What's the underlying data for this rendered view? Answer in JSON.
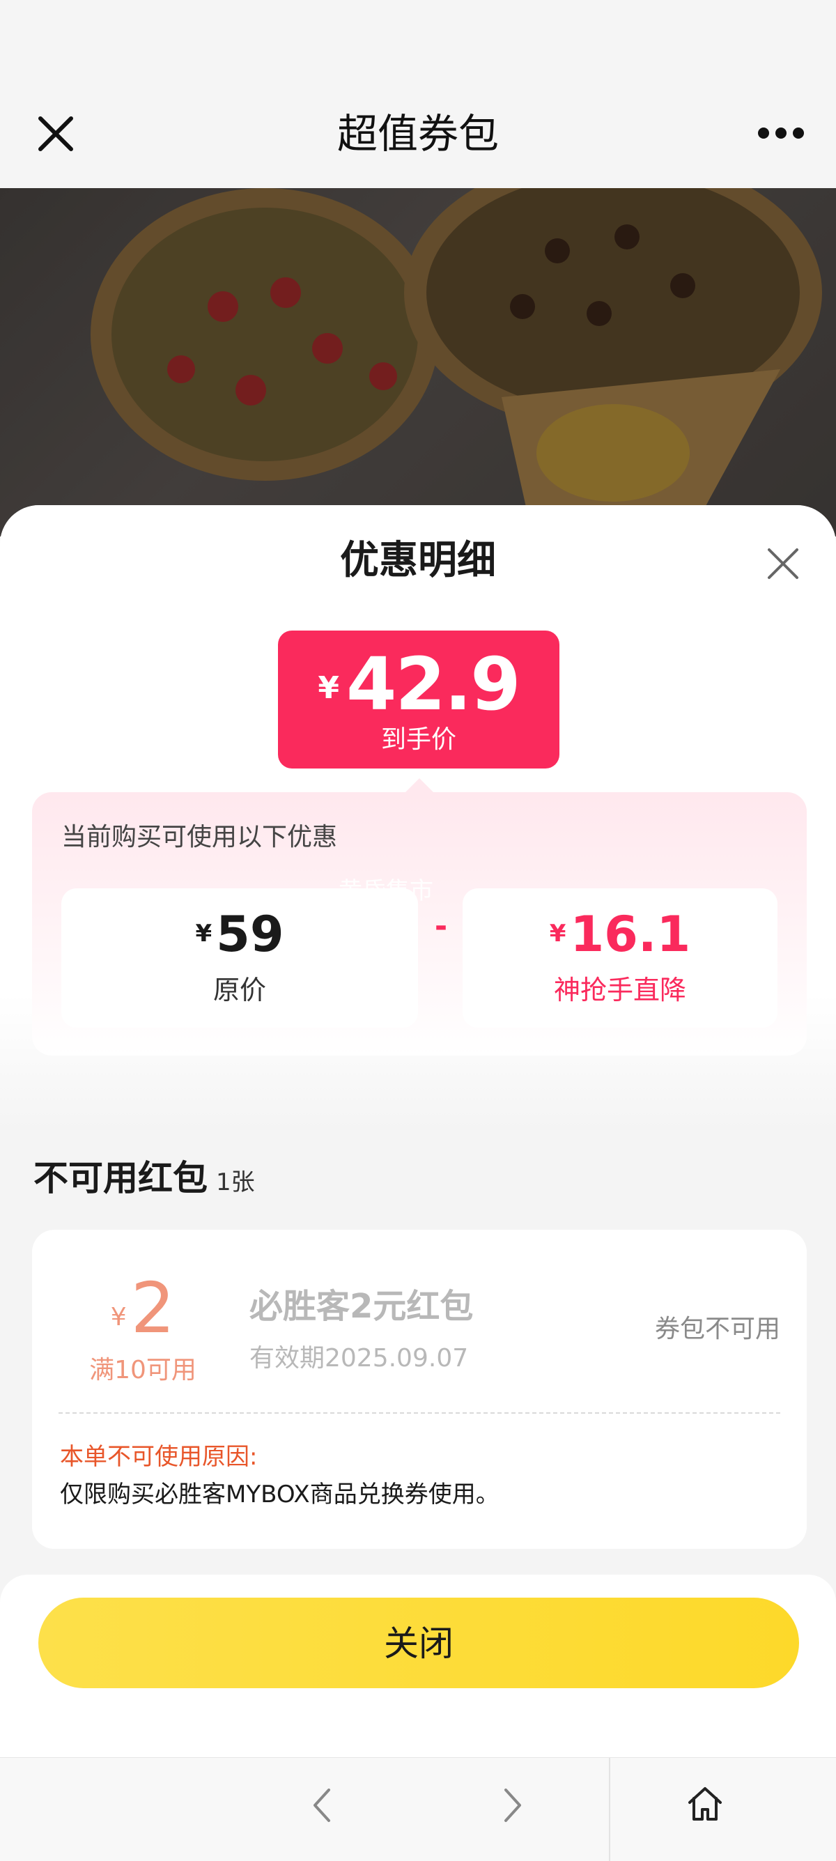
{
  "nav": {
    "title": "超值券包"
  },
  "sheet": {
    "title": "优惠明细",
    "final_price": {
      "currency": "¥",
      "value": "42.9",
      "label": "到手价"
    },
    "discount_panel": {
      "heading": "当前购买可使用以下优惠",
      "watermark": "黄昏集市",
      "original": {
        "currency": "¥",
        "value": "59",
        "label": "原价"
      },
      "operator": "-",
      "reduction": {
        "currency": "¥",
        "value": "16.1",
        "label": "神抢手直降"
      }
    }
  },
  "unusable": {
    "title": "不可用红包",
    "count": "1张",
    "coupon": {
      "currency": "¥",
      "amount": "2",
      "threshold": "满10可用",
      "name": "必胜客2元红包",
      "expiry": "有效期2025.09.07",
      "status": "券包不可用",
      "reason_title": "本单不可使用原因:",
      "reason_text": "仅限购买必胜客MYBOX商品兑换券使用。"
    }
  },
  "footer": {
    "close_label": "关闭"
  },
  "colors": {
    "accent_red": "#fa2a5c",
    "button_yellow": "#fdd92a",
    "coupon_orange": "#f0957a",
    "reason_red": "#e8562a"
  },
  "icons": {
    "nav_close": "close-icon",
    "nav_more": "more-icon",
    "sheet_close": "close-icon",
    "back": "chevron-left-icon",
    "forward": "chevron-right-icon",
    "home": "home-icon"
  }
}
